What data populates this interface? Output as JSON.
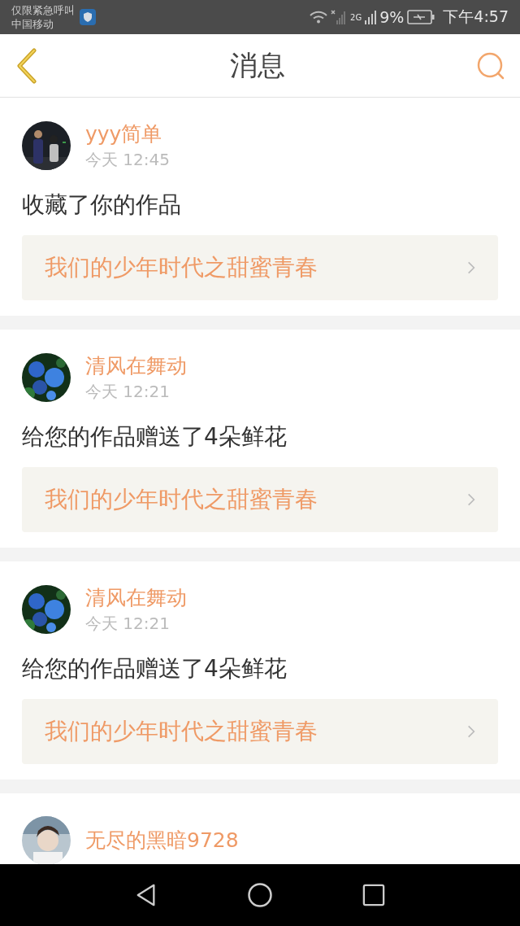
{
  "status_bar": {
    "notice": "仅限紧急呼叫",
    "carrier": "中国移动",
    "network": "2G",
    "battery": "9%",
    "time": "下午4:57"
  },
  "header": {
    "title": "消息"
  },
  "messages": [
    {
      "user": "yyy简单",
      "time": "今天 12:45",
      "action": "收藏了你的作品",
      "work": "我们的少年时代之甜蜜青春"
    },
    {
      "user": "清风在舞动",
      "time": "今天 12:21",
      "action": "给您的作品赠送了4朵鲜花",
      "work": "我们的少年时代之甜蜜青春"
    },
    {
      "user": "清风在舞动",
      "time": "今天 12:21",
      "action": "给您的作品赠送了4朵鲜花",
      "work": "我们的少年时代之甜蜜青春"
    },
    {
      "user": "无尽的黑暗9728"
    }
  ]
}
